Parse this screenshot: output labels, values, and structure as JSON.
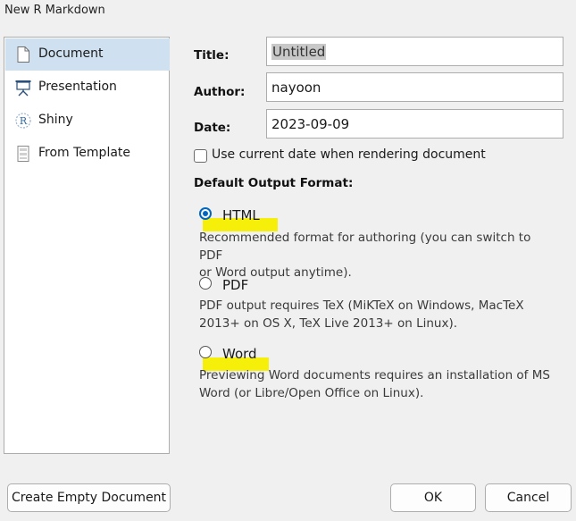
{
  "window": {
    "title": "New R Markdown"
  },
  "sidebar": {
    "items": [
      {
        "label": "Document",
        "icon": "document-icon",
        "selected": true
      },
      {
        "label": "Presentation",
        "icon": "presentation-icon",
        "selected": false
      },
      {
        "label": "Shiny",
        "icon": "shiny-r-icon",
        "selected": false
      },
      {
        "label": "From Template",
        "icon": "template-icon",
        "selected": false
      }
    ]
  },
  "form": {
    "title_label": "Title:",
    "title_value": "Untitled",
    "author_label": "Author:",
    "author_value": "nayoon",
    "date_label": "Date:",
    "date_value": "2023-09-09",
    "use_current_date_label": "Use current date when rendering document",
    "use_current_date_checked": false
  },
  "output": {
    "heading": "Default Output Format:",
    "options": [
      {
        "label": "HTML",
        "checked": true,
        "desc_line1": "Recommended format for authoring (you can switch to PDF",
        "desc_line2": "or Word output anytime)."
      },
      {
        "label": "PDF",
        "checked": false,
        "desc_line1": "PDF output requires TeX (MiKTeX on Windows, MacTeX",
        "desc_line2": "2013+ on OS X, TeX Live 2013+ on Linux)."
      },
      {
        "label": "Word",
        "checked": false,
        "desc_line1": "Previewing Word documents requires an installation of MS",
        "desc_line2": "Word (or Libre/Open Office on Linux)."
      }
    ]
  },
  "buttons": {
    "create_empty": "Create Empty Document",
    "ok": "OK",
    "cancel": "Cancel"
  },
  "colors": {
    "selection": "#cfe1f1",
    "radio_accent": "#0067c0",
    "highlight": "#f5ef0a"
  }
}
